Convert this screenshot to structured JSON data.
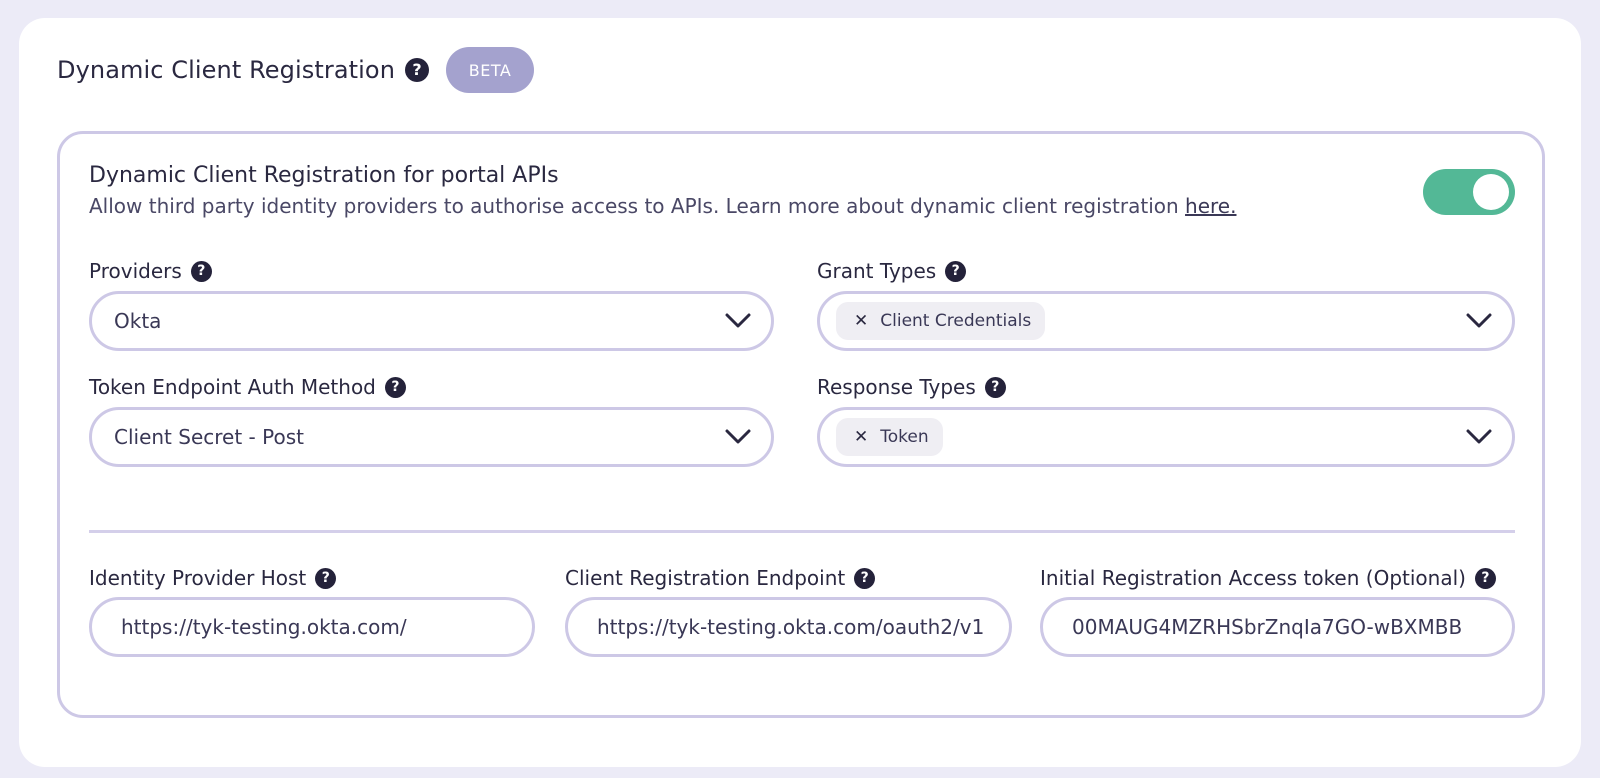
{
  "header": {
    "title": "Dynamic Client Registration",
    "badge": "BETA",
    "help_glyph": "?"
  },
  "panel": {
    "title": "Dynamic Client Registration for portal APIs",
    "description": "Allow third party identity providers to authorise access to APIs. Learn more about dynamic client registration ",
    "link_text": "here.",
    "toggle_enabled": true,
    "toggle_color": "#53b896"
  },
  "fields": {
    "providers": {
      "label": "Providers",
      "value": "Okta"
    },
    "grant_types": {
      "label": "Grant Types",
      "chips": [
        "Client Credentials"
      ]
    },
    "token_auth": {
      "label": "Token Endpoint Auth Method",
      "value": "Client Secret - Post"
    },
    "response_types": {
      "label": "Response Types",
      "chips": [
        "Token"
      ]
    },
    "idp_host": {
      "label": "Identity Provider Host",
      "value": "https://tyk-testing.okta.com/"
    },
    "reg_endpoint": {
      "label": "Client Registration Endpoint",
      "value": "https://tyk-testing.okta.com/oauth2/v1"
    },
    "access_token": {
      "label": "Initial Registration Access token (Optional)",
      "value": "00MAUG4MZRHSbrZnqIa7GO-wBXMBB"
    }
  },
  "icons": {
    "help": "help-circle-icon",
    "chevron": "chevron-down-icon",
    "remove": "close-icon"
  }
}
